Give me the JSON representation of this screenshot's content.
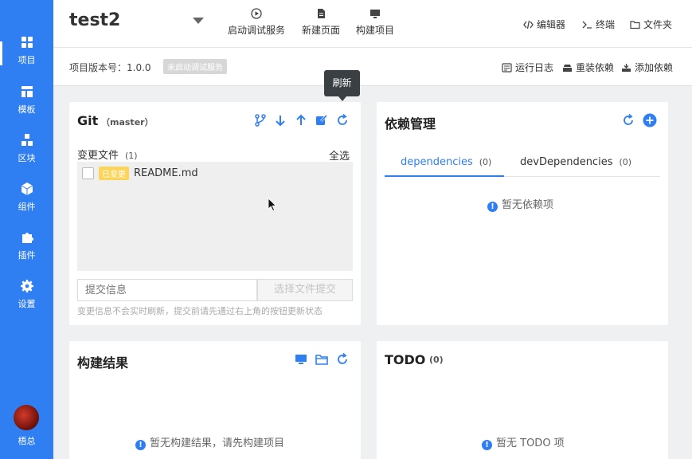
{
  "sidebar": {
    "items": [
      {
        "label": "项目",
        "icon": "dashboard-icon"
      },
      {
        "label": "模板",
        "icon": "template-icon"
      },
      {
        "label": "区块",
        "icon": "blocks-icon"
      },
      {
        "label": "组件",
        "icon": "cube-icon"
      },
      {
        "label": "插件",
        "icon": "puzzle-icon"
      },
      {
        "label": "设置",
        "icon": "gear-icon"
      }
    ],
    "user_name": "梧总"
  },
  "header": {
    "project_title": "test2",
    "actions": [
      {
        "label": "启动调试服务",
        "icon": "play-circle-icon"
      },
      {
        "label": "新建页面",
        "icon": "new-page-icon"
      },
      {
        "label": "构建项目",
        "icon": "monitor-icon"
      }
    ],
    "links": [
      {
        "label": "编辑器",
        "icon": "code-icon"
      },
      {
        "label": "终端",
        "icon": "terminal-icon"
      },
      {
        "label": "文件夹",
        "icon": "folder-icon"
      }
    ]
  },
  "subheader": {
    "version_text": "项目版本号：1.0.0",
    "service_badge": "未启动调试服务",
    "links": [
      {
        "label": "运行日志",
        "icon": "log-icon"
      },
      {
        "label": "重装依赖",
        "icon": "reinstall-icon"
      },
      {
        "label": "添加依赖",
        "icon": "add-dep-icon"
      }
    ]
  },
  "git": {
    "title": "Git",
    "branch": "（master）",
    "changes_label": "变更文件",
    "changes_count": "(1)",
    "select_all": "全选",
    "files": [
      {
        "tag": "已变更",
        "name": "README.md"
      }
    ],
    "commit_placeholder": "提交信息",
    "commit_button": "选择文件提交",
    "hint": "变更信息不会实时刷新，提交前请先通过右上角的按钮更新状态",
    "tooltip": "刷新"
  },
  "deps": {
    "title": "依赖管理",
    "tabs": [
      {
        "label": "dependencies",
        "count": "(0)"
      },
      {
        "label": "devDependencies",
        "count": "(0)"
      }
    ],
    "empty": "暂无依赖项"
  },
  "build": {
    "title": "构建结果",
    "empty": "暂无构建结果，请先构建项目"
  },
  "todo": {
    "title": "TODO",
    "count": "(0)",
    "empty": "暂无 TODO 项"
  },
  "colors": {
    "accent": "#2f7ff3",
    "sidebar": "#2f7ff3",
    "badge_changed": "#fbd45a"
  }
}
